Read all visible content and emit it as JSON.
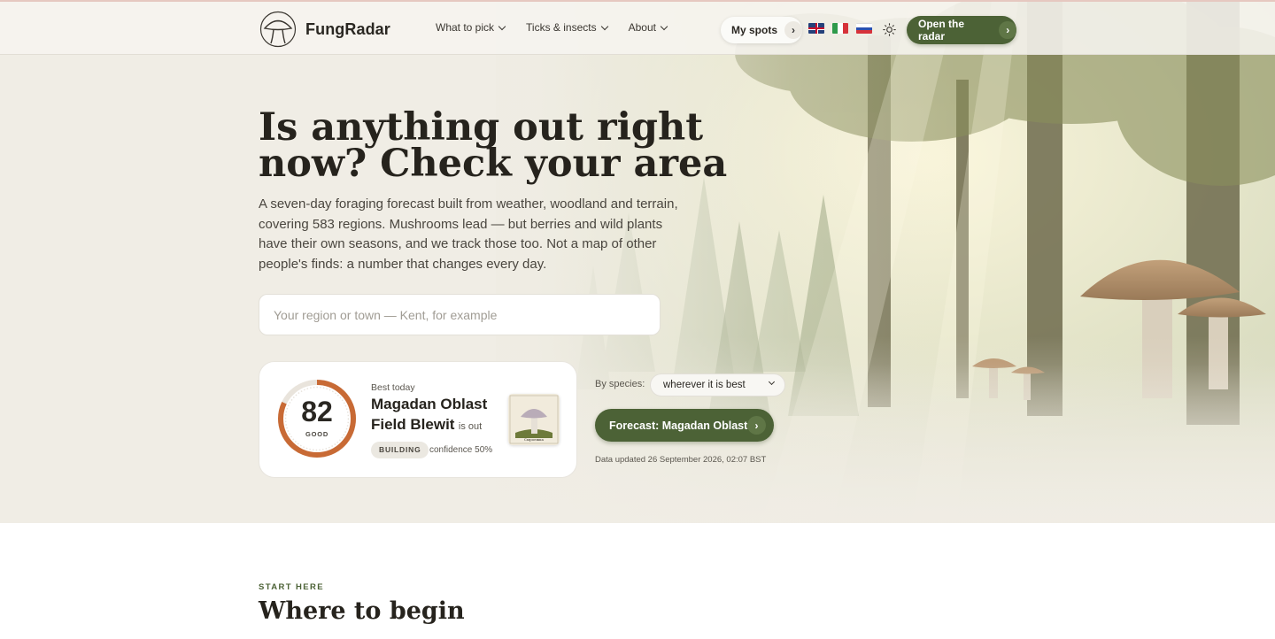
{
  "nav": {
    "logo_text": "FungRadar",
    "links": [
      {
        "label": "What to pick"
      },
      {
        "label": "Ticks & insects"
      },
      {
        "label": "About"
      }
    ],
    "my_spots_label": "My spots",
    "languages": [
      "en",
      "it",
      "ru"
    ],
    "open_radar_label": "Open the radar"
  },
  "hero": {
    "title": "Is anything out right now? Check your area",
    "description": "A seven-day foraging forecast built from weather, woodland and terrain, covering 583 regions. Mushrooms lead — but berries and wild plants have their own seasons, and we track those too. Not a map of other people's finds: a number that changes every day.",
    "search_placeholder": "Your region or town — Kent, for example"
  },
  "best_today": {
    "label": "Best today",
    "score": "82",
    "score_fraction": 0.82,
    "score_label": "GOOD",
    "region": "Magadan Oblast",
    "species": "Field Blewit",
    "is_out_text": "is out",
    "status": "BUILDING",
    "confidence": "confidence 50%",
    "image_caption": "Сыроежка"
  },
  "controls": {
    "by_species_label": "By species:",
    "species_select_value": "wherever it is best",
    "forecast_button_label": "Forecast: Magadan Oblast",
    "data_updated": "Data updated 26 September 2026, 02:07 BST"
  },
  "start": {
    "eyebrow": "START HERE",
    "title": "Where to begin"
  },
  "colors": {
    "accent_green": "#4c6236",
    "gauge_orange": "#c86a35"
  }
}
